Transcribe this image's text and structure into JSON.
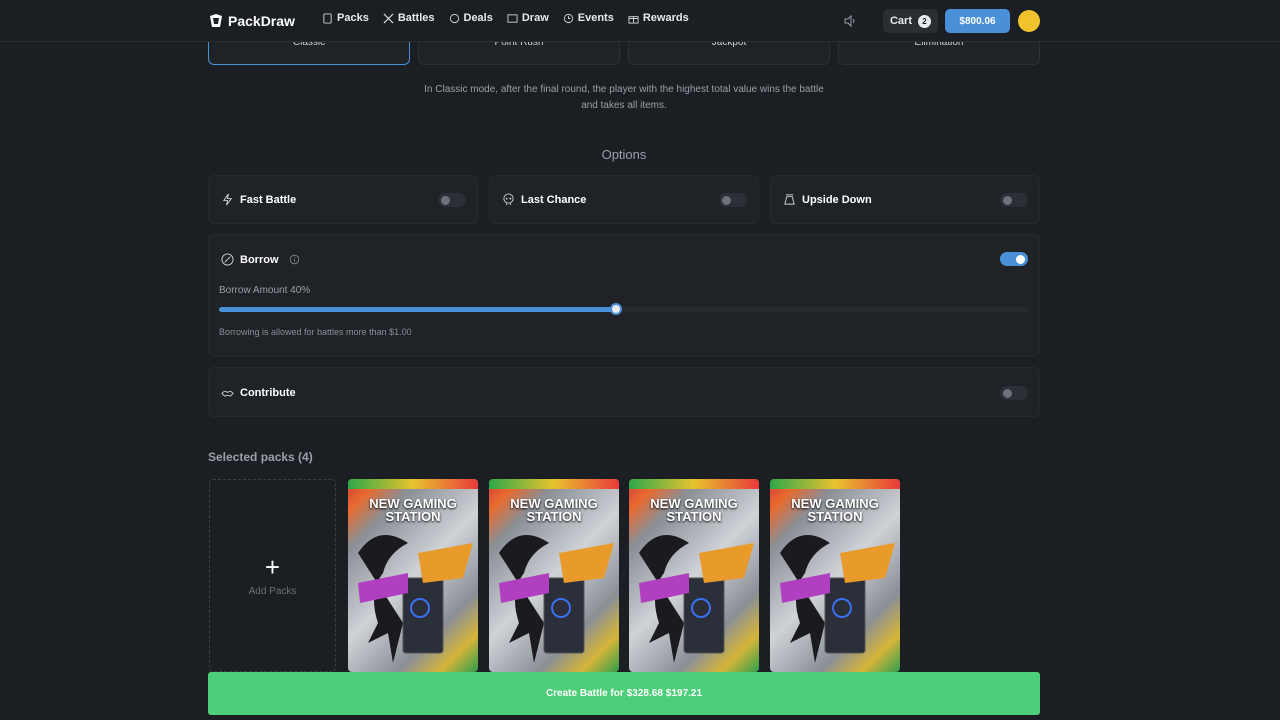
{
  "header": {
    "logo": "PackDraw",
    "nav": [
      {
        "label": "Packs",
        "icon": "pack-icon"
      },
      {
        "label": "Battles",
        "icon": "swords-icon"
      },
      {
        "label": "Deals",
        "icon": "deals-icon"
      },
      {
        "label": "Draw",
        "icon": "draw-icon"
      },
      {
        "label": "Events",
        "icon": "events-icon"
      },
      {
        "label": "Rewards",
        "icon": "gift-icon"
      }
    ],
    "cart_label": "Cart",
    "cart_count": "2",
    "balance": "$800.06"
  },
  "modes": {
    "tabs": [
      "Classic",
      "Point Rush",
      "Jackpot",
      "Elimination"
    ],
    "active": "Classic",
    "description_line1": "In Classic mode, after the final round, the player with the highest total value wins the battle",
    "description_line2": "and takes all items."
  },
  "options": {
    "title": "Options",
    "fast_battle": {
      "label": "Fast Battle",
      "enabled": false
    },
    "last_chance": {
      "label": "Last Chance",
      "enabled": false
    },
    "upside_down": {
      "label": "Upside Down",
      "enabled": false
    },
    "borrow": {
      "label": "Borrow",
      "enabled": true,
      "amount_label": "Borrow Amount 40%",
      "amount_percent": 40,
      "note": "Borrowing is allowed for battles more than $1.00"
    },
    "contribute": {
      "label": "Contribute",
      "enabled": false
    }
  },
  "packs": {
    "title": "Selected packs (4)",
    "add_label": "Add Packs",
    "items": [
      {
        "title_line1": "NEW GAMING",
        "title_line2": "STATION"
      },
      {
        "title_line1": "NEW GAMING",
        "title_line2": "STATION"
      },
      {
        "title_line1": "NEW GAMING",
        "title_line2": "STATION"
      },
      {
        "title_line1": "NEW GAMING",
        "title_line2": "STATION"
      }
    ]
  },
  "create_button": {
    "label": "Create Battle for",
    "price_original": "$328.68",
    "price_final": "$197.21"
  },
  "colors": {
    "background": "#1b1e22",
    "accent": "#4a90d9",
    "create": "#4ccf78"
  }
}
